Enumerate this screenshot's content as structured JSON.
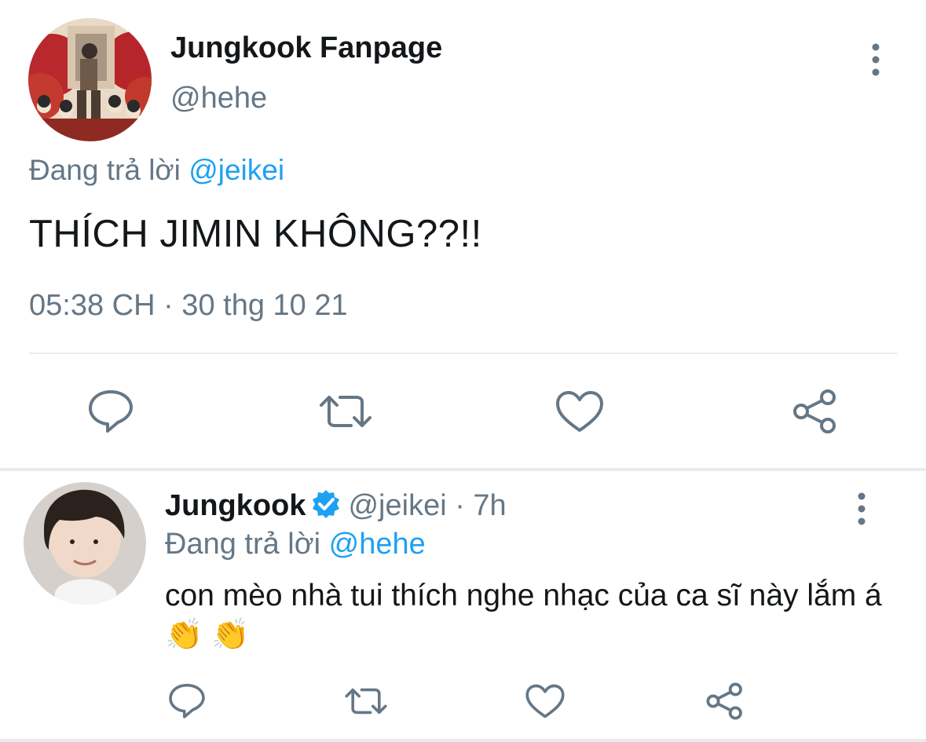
{
  "main_tweet": {
    "display_name": "Jungkook Fanpage",
    "handle": "@hehe",
    "reply_prefix": "Đang trả lời ",
    "reply_mention": "@jeikei",
    "text": "THÍCH JIMIN KHÔNG??!!",
    "timestamp": "05:38 CH · 30 thg 10 21",
    "actions": [
      "reply-icon",
      "retweet-icon",
      "like-icon",
      "share-icon"
    ]
  },
  "reply_tweet": {
    "display_name": "Jungkook",
    "handle": "@jeikei",
    "time_ago": "· 7h",
    "reply_prefix": "Đang trả lời ",
    "reply_mention": "@hehe",
    "text": "con mèo nhà tui thích nghe nhạc của ca sĩ này lắm á 👏 👏",
    "actions": [
      "reply-icon",
      "retweet-icon",
      "like-icon",
      "share-icon"
    ]
  },
  "colors": {
    "accent": "#1da1f2",
    "secondary_text": "#657786",
    "icon": "#657786",
    "divider": "#e6ecf0"
  }
}
